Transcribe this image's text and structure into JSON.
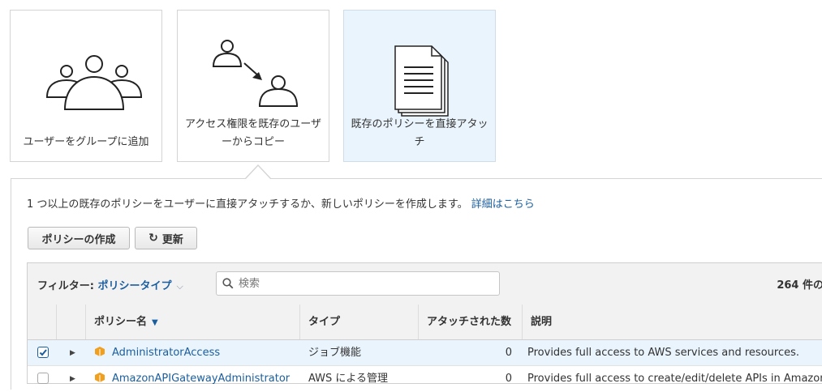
{
  "options": [
    {
      "label": "ユーザーをグループに追加",
      "icon": "group-users-icon",
      "selected": false
    },
    {
      "label": "アクセス権限を既存のユーザーからコピー",
      "icon": "copy-user-permissions-icon",
      "selected": false
    },
    {
      "label": "既存のポリシーを直接アタッチ",
      "icon": "policy-document-icon",
      "selected": true
    }
  ],
  "description": {
    "text": "1 つ以上の既存のポリシーをユーザーに直接アタッチするか、新しいポリシーを作成します。",
    "link": "詳細はこちら"
  },
  "toolbar": {
    "create_label": "ポリシーの作成",
    "refresh_label": "更新",
    "refresh_icon": "refresh-icon"
  },
  "filter": {
    "label": "フィルター:",
    "value": "ポリシータイプ",
    "search_placeholder": "検索",
    "count": "264 件の"
  },
  "table": {
    "headers": {
      "name": "ポリシー名",
      "type": "タイプ",
      "attached": "アタッチされた数",
      "description": "説明"
    },
    "rows": [
      {
        "checked": true,
        "name": "AdministratorAccess",
        "type": "ジョブ機能",
        "attached": "0",
        "description": "Provides full access to AWS services and resources."
      },
      {
        "checked": false,
        "name": "AmazonAPIGatewayAdministrator",
        "type": "AWS による管理",
        "attached": "0",
        "description": "Provides full access to create/edit/delete APIs in Amazon API Gateway via the AWS Management Console."
      }
    ]
  },
  "colors": {
    "link": "#1a5e9f",
    "selected_bg": "#eaf4fd",
    "policy_icon": "#f0a020"
  }
}
